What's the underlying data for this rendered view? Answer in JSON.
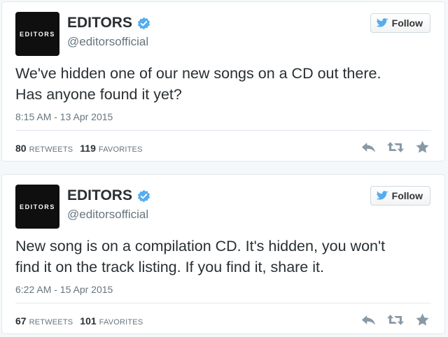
{
  "tweets": [
    {
      "avatar_text": "EDITORS",
      "display_name": "EDITORS",
      "handle": "@editorsofficial",
      "follow_label": "Follow",
      "text_line1": "We've hidden one of our new songs on a CD out there.",
      "text_line2": "Has anyone found it yet?",
      "timestamp": "8:15 AM - 13 Apr 2015",
      "retweets": "80",
      "retweets_label": "RETWEETS",
      "favorites": "119",
      "favorites_label": "FAVORITES"
    },
    {
      "avatar_text": "EDITORS",
      "display_name": "EDITORS",
      "handle": "@editorsofficial",
      "follow_label": "Follow",
      "text_line1": "New song is on a compilation CD. It's hidden, you won't",
      "text_line2": "find it on the track listing. If you find it, share it.",
      "timestamp": "6:22 AM - 15 Apr 2015",
      "retweets": "67",
      "retweets_label": "RETWEETS",
      "favorites": "101",
      "favorites_label": "FAVORITES"
    }
  ],
  "icons": {
    "verified": "verified-badge-icon",
    "follow_bird": "twitter-bird-icon",
    "reply": "reply-icon",
    "retweet": "retweet-icon",
    "favorite": "star-icon"
  },
  "colors": {
    "verified": "#55acee",
    "bird": "#55acee",
    "action_icons": "#8899a6"
  }
}
